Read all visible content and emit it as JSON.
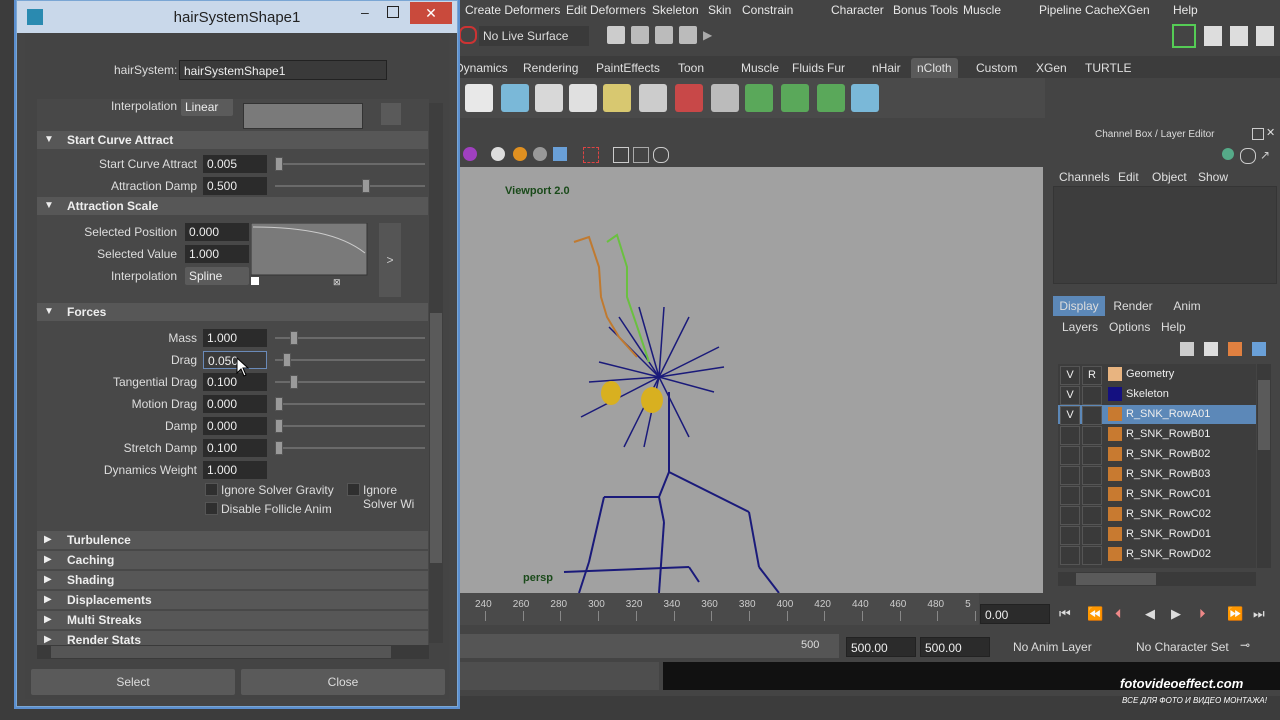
{
  "menubar": [
    "Create Deformers",
    "Edit Deformers",
    "Skeleton",
    "Skin",
    "Constrain",
    "Character",
    "Bonus Tools",
    "Muscle",
    "Pipeline Cache",
    "XGen",
    "Help"
  ],
  "statusline": {
    "live_surface": "No Live Surface"
  },
  "shelf_tabs": [
    "Dynamics",
    "Rendering",
    "PaintEffects",
    "Toon",
    "Muscle",
    "Fluids",
    "Fur",
    "nHair",
    "nCloth",
    "Custom",
    "XGen",
    "TURTLE"
  ],
  "shelf_active_tab": "nCloth",
  "viewport": {
    "label": "Viewport 2.0",
    "camera": "persp"
  },
  "timeline": {
    "ticks": [
      "240",
      "260",
      "280",
      "300",
      "320",
      "340",
      "360",
      "380",
      "400",
      "420",
      "440",
      "460",
      "480",
      "5"
    ],
    "current_frame": "0.00"
  },
  "range": {
    "end_shown": "500",
    "end_a": "500.00",
    "end_b": "500.00",
    "anim_layer": "No Anim Layer",
    "char_set": "No Character Set"
  },
  "channel_box": {
    "title": "Channel Box / Layer Editor",
    "menu": [
      "Channels",
      "Edit",
      "Object",
      "Show"
    ],
    "layer_tabs": [
      "Display",
      "Render",
      "Anim"
    ],
    "layer_menu": [
      "Layers",
      "Options",
      "Help"
    ],
    "layers": [
      {
        "v": "V",
        "r": "R",
        "name": "Geometry",
        "color": "#e8b480",
        "selected": false
      },
      {
        "v": "V",
        "r": "",
        "name": "Skeleton",
        "color": "#141080",
        "selected": false
      },
      {
        "v": "V",
        "r": "",
        "name": "R_SNK_RowA01",
        "color": "#c87a30",
        "selected": true
      },
      {
        "v": "",
        "r": "",
        "name": "R_SNK_RowB01",
        "color": "#c87a30",
        "selected": false
      },
      {
        "v": "",
        "r": "",
        "name": "R_SNK_RowB02",
        "color": "#c87a30",
        "selected": false
      },
      {
        "v": "",
        "r": "",
        "name": "R_SNK_RowB03",
        "color": "#c87a30",
        "selected": false
      },
      {
        "v": "",
        "r": "",
        "name": "R_SNK_RowC01",
        "color": "#c87a30",
        "selected": false
      },
      {
        "v": "",
        "r": "",
        "name": "R_SNK_RowC02",
        "color": "#c87a30",
        "selected": false
      },
      {
        "v": "",
        "r": "",
        "name": "R_SNK_RowD01",
        "color": "#c87a30",
        "selected": false
      },
      {
        "v": "",
        "r": "",
        "name": "R_SNK_RowD02",
        "color": "#c87a30",
        "selected": false
      }
    ]
  },
  "attr_editor": {
    "title": "hairSystemShape1",
    "hairsystem_label": "hairSystem:",
    "hairsystem_value": "hairSystemShape1",
    "top_interp_label": "Interpolation",
    "top_interp_value": "Linear",
    "start_curve": {
      "header": "Start Curve Attract",
      "attract_label": "Start Curve Attract",
      "attract_value": "0.005",
      "damp_label": "Attraction Damp",
      "damp_value": "0.500"
    },
    "attraction_scale": {
      "header": "Attraction Scale",
      "pos_label": "Selected Position",
      "pos_value": "0.000",
      "val_label": "Selected Value",
      "val_value": "1.000",
      "interp_label": "Interpolation",
      "interp_value": "Spline",
      "expand": ">"
    },
    "forces": {
      "header": "Forces",
      "rows": [
        {
          "label": "Mass",
          "value": "1.000",
          "level": 0.1
        },
        {
          "label": "Drag",
          "value": "0.050",
          "level": 0.05
        },
        {
          "label": "Tangential Drag",
          "value": "0.100",
          "level": 0.1
        },
        {
          "label": "Motion Drag",
          "value": "0.000",
          "level": 0.0
        },
        {
          "label": "Damp",
          "value": "0.000",
          "level": 0.0
        },
        {
          "label": "Stretch Damp",
          "value": "0.100",
          "level": 0.0
        },
        {
          "label": "Dynamics Weight",
          "value": "1.000",
          "level": null
        }
      ],
      "ignore_gravity": "Ignore Solver Gravity",
      "ignore_wind": "Ignore Solver Wi",
      "disable_follicle": "Disable Follicle Anim"
    },
    "collapsed_sections": [
      "Turbulence",
      "Caching",
      "Shading",
      "Displacements",
      "Multi Streaks",
      "Render Stats"
    ],
    "select_button": "Select",
    "close_button": "Close"
  },
  "watermark": {
    "main": "fotovideoeffect.com",
    "sub": "ВСЕ ДЛЯ ФОТО И ВИДЕО МОНТАЖА!"
  },
  "colors": {
    "selection": "#5c88b8",
    "titlebar": "#c9d8ea",
    "close": "#c94a3c",
    "viewport_bg": "#a1a1a1",
    "skeleton": "#1a1a7a"
  }
}
